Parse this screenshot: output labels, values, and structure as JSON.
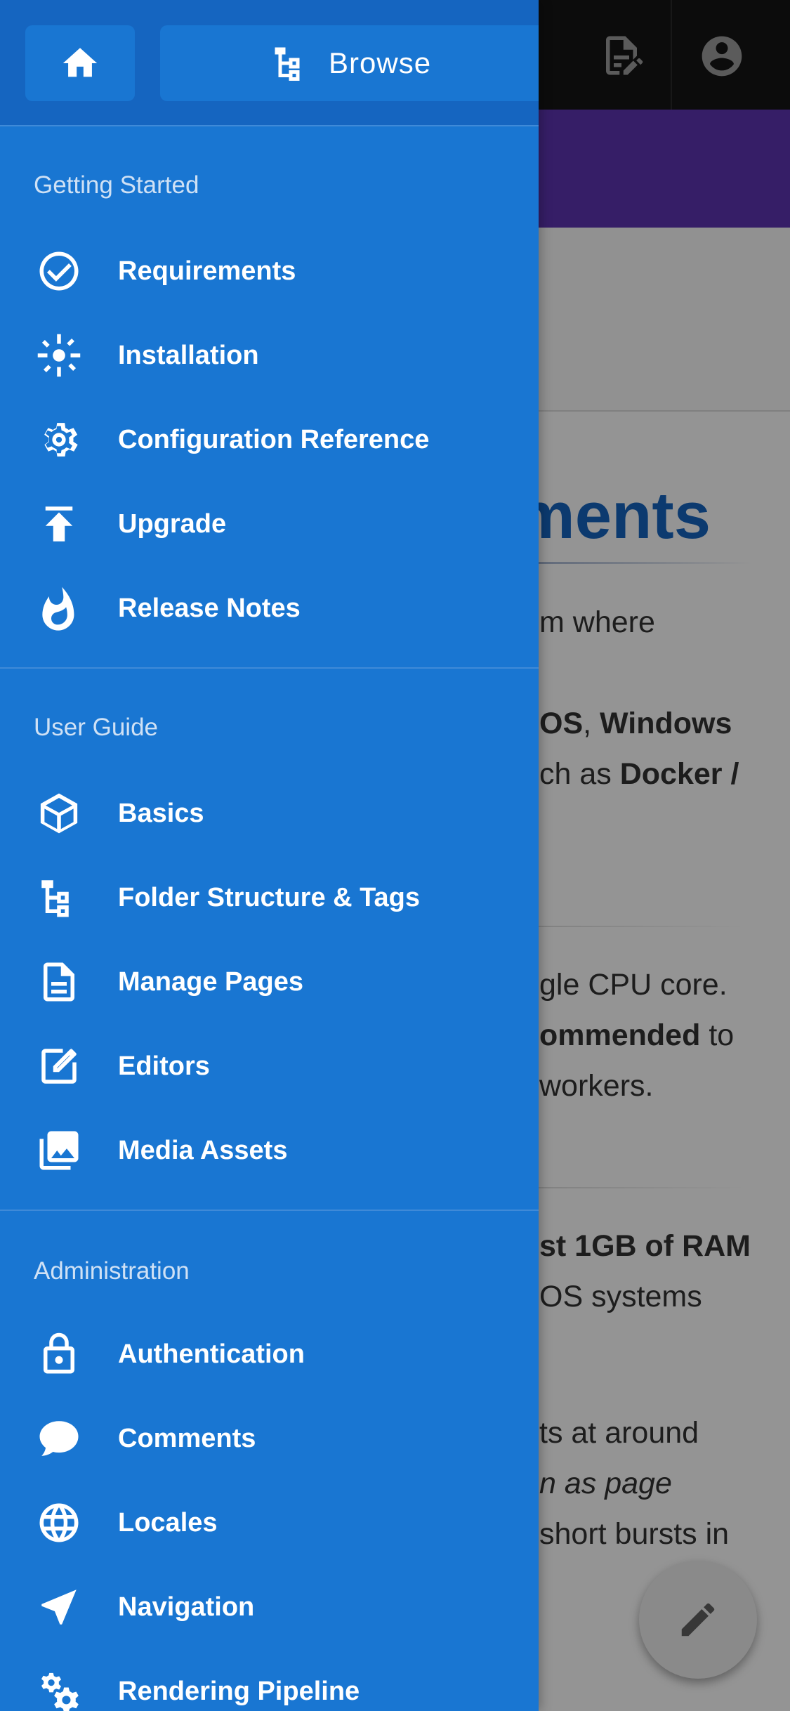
{
  "background_page": {
    "title_fragment": "ments",
    "lines": [
      {
        "text": "m where"
      },
      {
        "text_html": "OS, Windows"
      },
      {
        "text_html": "ch as Docker /"
      },
      {
        "text": "gle CPU core."
      },
      {
        "text_html": "ommended to"
      },
      {
        "text": " workers."
      },
      {
        "text_html": "st 1GB of RAM"
      },
      {
        "text": "OS systems"
      },
      {
        "text": "ts at around"
      },
      {
        "text_html": "n as page"
      },
      {
        "text": "short bursts in"
      }
    ],
    "fab_icon": "pencil-icon",
    "topbar_icons": [
      "edit-document-icon",
      "account-circle-icon"
    ]
  },
  "drawer": {
    "home_icon": "home-icon",
    "browse_label": "Browse",
    "browse_icon": "file-tree-icon",
    "sections": [
      {
        "title": "Getting Started",
        "items": [
          {
            "label": "Requirements",
            "icon": "check-circle-icon"
          },
          {
            "label": "Installation",
            "icon": "brightness-icon"
          },
          {
            "label": "Configuration Reference",
            "icon": "gear-icon"
          },
          {
            "label": "Upgrade",
            "icon": "upload-icon"
          },
          {
            "label": "Release Notes",
            "icon": "fire-icon"
          }
        ]
      },
      {
        "title": "User Guide",
        "items": [
          {
            "label": "Basics",
            "icon": "cube-icon"
          },
          {
            "label": "Folder Structure & Tags",
            "icon": "file-tree-icon"
          },
          {
            "label": "Manage Pages",
            "icon": "document-icon"
          },
          {
            "label": "Editors",
            "icon": "edit-box-icon"
          },
          {
            "label": "Media Assets",
            "icon": "image-multiple-icon"
          }
        ]
      },
      {
        "title": "Administration",
        "items": [
          {
            "label": "Authentication",
            "icon": "lock-icon"
          },
          {
            "label": "Comments",
            "icon": "comment-icon"
          },
          {
            "label": "Locales",
            "icon": "globe-icon"
          },
          {
            "label": "Navigation",
            "icon": "navigation-icon"
          },
          {
            "label": "Rendering Pipeline",
            "icon": "cogs-icon"
          }
        ]
      }
    ]
  },
  "colors": {
    "drawer_bg": "#1976d2",
    "drawer_header_bg": "#1565c0",
    "section_title": "#cfe1f5",
    "topbar": "#161616",
    "banner": "#5e35b1",
    "title_blue": "#1565c0"
  }
}
